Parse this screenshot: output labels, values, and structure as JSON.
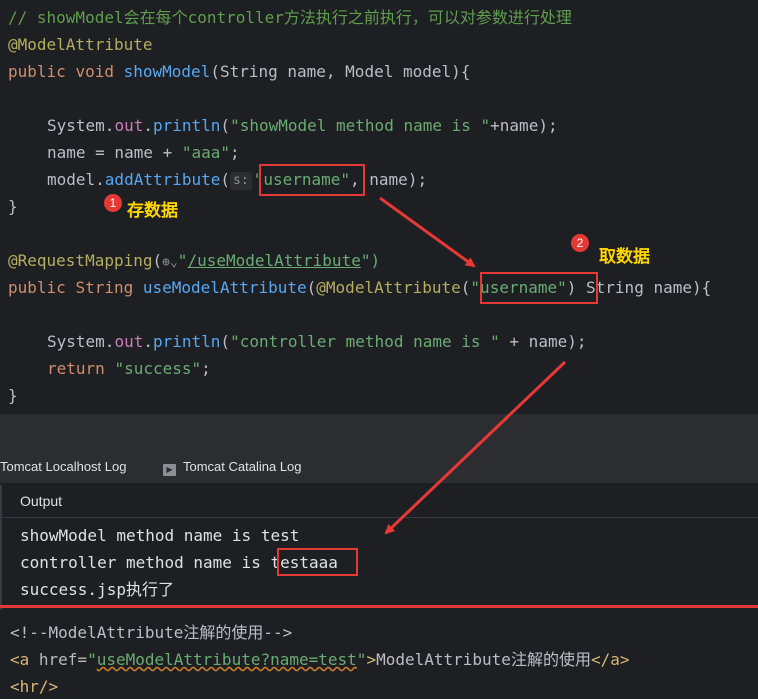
{
  "code": {
    "comment": "// showModel会在每个controller方法执行之前执行，可以对参数进行处理",
    "annotation1": "@ModelAttribute",
    "kw_public": "public",
    "kw_void": "void",
    "method1_name": "showModel",
    "method1_params": "(String name, Model model){",
    "system_out": "System.",
    "out_field": "out",
    "println": "println",
    "str1": "\"showModel method name is \"",
    "str1_rest": "+name);",
    "line_name": "name = name + ",
    "str_aaa": "\"aaa\"",
    "semicolon": ";",
    "model_dot": "model.",
    "add_attr": "addAttribute",
    "paren_open": "(",
    "hint_s": "s:",
    "str_username": "\"username\"",
    "add_attr_rest": ", name);",
    "brace_close": "}",
    "request_mapping": "@RequestMapping",
    "route_quote_open": "\"",
    "route_path": "/useModelAttribute",
    "route_close": "\")",
    "kw_string": "String",
    "method2_name": "useModelAttribute",
    "ann_model_attr": "@ModelAttribute",
    "method2_rest": " String name){",
    "str2": "\"controller method name is \"",
    "str2_rest": " + name);",
    "kw_return": "return",
    "str_success": "\"success\"",
    "globe_icon": "⊕⌄"
  },
  "annotations": {
    "badge1": "1",
    "label1": "存数据",
    "badge2": "2",
    "label2": "取数据"
  },
  "tabs": {
    "tab1": "Tomcat Localhost Log",
    "tab2": "Tomcat Catalina Log",
    "tab2_icon": "terminal-icon"
  },
  "output": {
    "title": "Output",
    "line1": "showModel method name is test",
    "line2_prefix": "controller method name is ",
    "line2_value": "testaaa",
    "line3": "success.jsp执行了"
  },
  "html_code": {
    "comment": "<!--ModelAttribute注解的使用-->",
    "a_open": "<a",
    "href_attr": " href=",
    "href_q1": "\"",
    "href_val": "useModelAttribute?name=test",
    "href_q2": "\"",
    "a_close_bracket": ">",
    "link_text": "ModelAttribute注解的使用",
    "a_end": "</a>",
    "hr": "<hr/>"
  },
  "colors": {
    "highlight": "#e53935",
    "annotation_text": "#ffd600"
  }
}
